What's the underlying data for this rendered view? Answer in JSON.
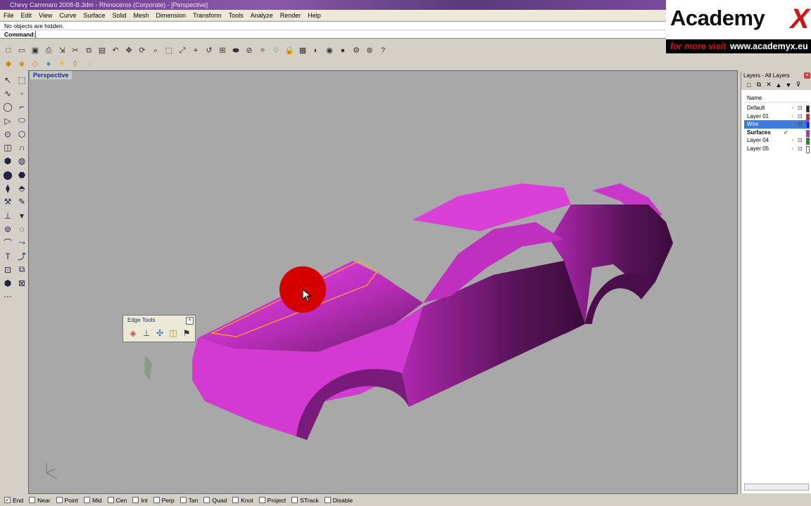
{
  "window": {
    "title": "Chevy Cammaro 2008-B.3dm - Rhinoceros (Corporate) - [Perspective]"
  },
  "menu": [
    "File",
    "Edit",
    "View",
    "Curve",
    "Surface",
    "Solid",
    "Mesh",
    "Dimension",
    "Transform",
    "Tools",
    "Analyze",
    "Render",
    "Help"
  ],
  "command": {
    "history": "No objects are hidden.",
    "prompt_label": "Command:",
    "input_value": ""
  },
  "logo": {
    "brand": "Academy",
    "brand_x": "X",
    "tagline_prefix": "for more visit",
    "url": "www.academyx.eu"
  },
  "toolbar1": [
    "new-icon",
    "open-icon",
    "save-icon",
    "print-icon",
    "import-icon",
    "cut-icon",
    "copy-icon",
    "paste-icon",
    "undo-icon",
    "pan-icon",
    "rotate-icon",
    "zoom-icon",
    "zoom-window-icon",
    "zoom-extents-icon",
    "zoom-selected-icon",
    "undo-view-icon",
    "four-view-icon",
    "car-icon",
    "trim-icon",
    "osnap-icon",
    "light-icon",
    "lock-icon",
    "grid-icon",
    "shade-icon",
    "render-icon",
    "material-icon",
    "settings-icon",
    "plugin-icon",
    "help-icon"
  ],
  "toolbar1_glyphs": [
    "□",
    "▭",
    "▣",
    "⎙",
    "⇲",
    "✂",
    "⧉",
    "▤",
    "↶",
    "✥",
    "⟳",
    "⌕",
    "⬚",
    "⤢",
    "⌖",
    "↺",
    "⊞",
    "⬬",
    "⊘",
    "✧",
    "♢",
    "🔒",
    "▦",
    "◐",
    "◉",
    "●",
    "⚙",
    "⊛",
    "?"
  ],
  "toolbar2_glyphs": [
    "◆",
    "◈",
    "◇",
    "●",
    "✶",
    "◊",
    "○"
  ],
  "left_tools": [
    "↖",
    "⬚",
    "∿",
    "◦",
    "◯",
    "⌐",
    "▷",
    "⬭",
    "⊙",
    "⬡",
    "◫",
    "∩",
    "⬢",
    "◍",
    "⬤",
    "⬣",
    "⧫",
    "⬘",
    "⚒",
    "✎",
    "⊥",
    "▾",
    "⊚",
    "◌",
    "⌒",
    "⤳",
    "T",
    "⤴",
    "⊡",
    "⧉",
    "⬢",
    "⊠",
    "⋯"
  ],
  "viewport": {
    "label": "Perspective"
  },
  "edge_tools": {
    "title": "Edge Tools",
    "close": "×",
    "icons": [
      "◈",
      "⊥",
      "✣",
      "◫",
      "⚑"
    ]
  },
  "layers": {
    "panel_title": "Layers - All Layers",
    "column_header": "Name",
    "tools": [
      "□",
      "⧉",
      "✕",
      "▲",
      "▼",
      "⊽"
    ],
    "items": [
      {
        "name": "Default",
        "color": "#222222",
        "selected": false,
        "current": false
      },
      {
        "name": "Layer 01",
        "color": "#cc2222",
        "selected": false,
        "current": false
      },
      {
        "name": "Wire",
        "color": "#2222cc",
        "selected": true,
        "current": false
      },
      {
        "name": "Surfaces",
        "color": "#cc22cc",
        "selected": false,
        "current": true
      },
      {
        "name": "Layer 04",
        "color": "#228822",
        "selected": false,
        "current": false
      },
      {
        "name": "Layer 05",
        "color": "#ffffff",
        "selected": false,
        "current": false
      }
    ],
    "current_mark": "✓"
  },
  "status": {
    "snaps": [
      {
        "label": "End",
        "checked": true
      },
      {
        "label": "Near",
        "checked": false
      },
      {
        "label": "Point",
        "checked": false
      },
      {
        "label": "Mid",
        "checked": false
      },
      {
        "label": "Cen",
        "checked": false
      },
      {
        "label": "Int",
        "checked": false
      },
      {
        "label": "Perp",
        "checked": false
      },
      {
        "label": "Tan",
        "checked": false
      },
      {
        "label": "Quad",
        "checked": false
      },
      {
        "label": "Knot",
        "checked": false
      },
      {
        "label": "Project",
        "checked": false
      },
      {
        "label": "STrack",
        "checked": false
      },
      {
        "label": "Disable",
        "checked": false
      }
    ]
  },
  "colors": {
    "car_body": "#cc33cc",
    "viewport_bg": "#a8a8a8",
    "selection_outline": "#ffaa22",
    "cursor_highlight": "#d40000"
  }
}
